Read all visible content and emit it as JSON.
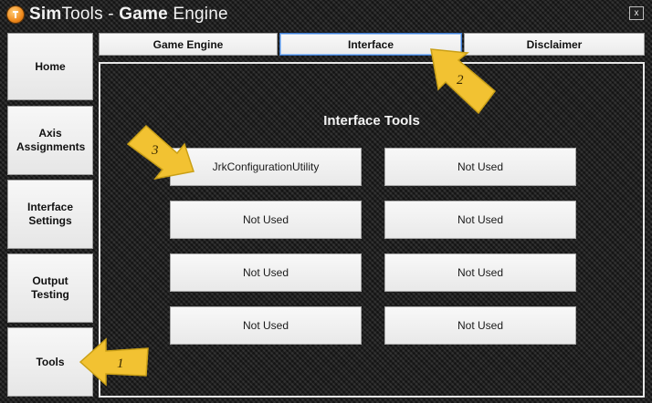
{
  "window": {
    "title_prefix": "Sim",
    "title_mid": "Tools - ",
    "title_bold": "Game",
    "title_suffix": " Engine",
    "close_label": "x"
  },
  "sidebar": {
    "items": [
      {
        "label": "Home"
      },
      {
        "label": "Axis Assignments"
      },
      {
        "label": "Interface Settings"
      },
      {
        "label": "Output Testing"
      },
      {
        "label": "Tools"
      }
    ]
  },
  "tabs": [
    {
      "label": "Game Engine"
    },
    {
      "label": "Interface",
      "active": true
    },
    {
      "label": "Disclaimer"
    }
  ],
  "main": {
    "title": "Interface Tools",
    "tools": [
      {
        "label": "JrkConfigurationUtility"
      },
      {
        "label": "Not Used"
      },
      {
        "label": "Not Used"
      },
      {
        "label": "Not Used"
      },
      {
        "label": "Not Used"
      },
      {
        "label": "Not Used"
      },
      {
        "label": "Not Used"
      },
      {
        "label": "Not Used"
      }
    ]
  },
  "annotations": [
    {
      "number": "1"
    },
    {
      "number": "2"
    },
    {
      "number": "3"
    }
  ],
  "colors": {
    "arrow_fill": "#f2c232",
    "active_tab_border": "#3d7bd1",
    "logo": "#f08a1c"
  }
}
